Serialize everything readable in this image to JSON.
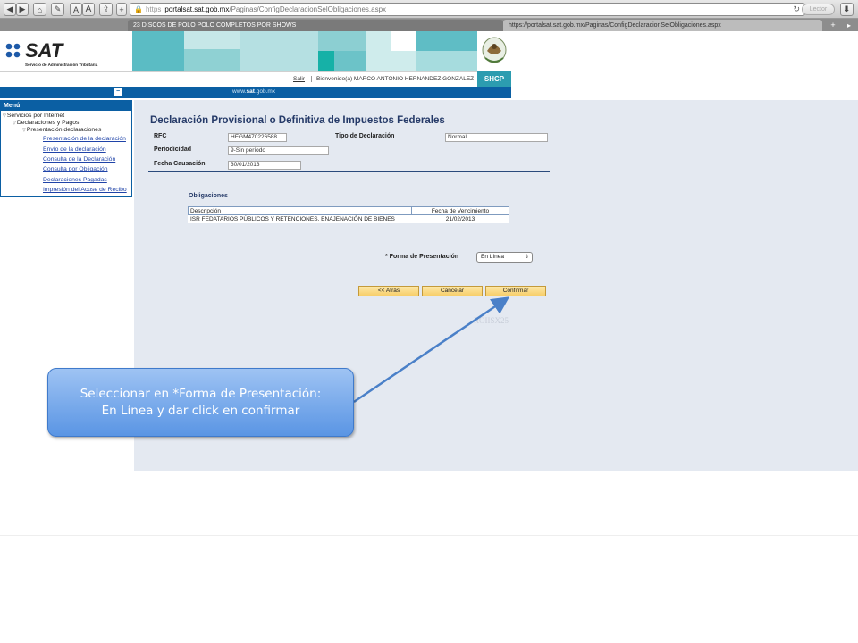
{
  "browser": {
    "address_https": "https",
    "address_domain": "portalsat.sat.gob.mx",
    "address_path": "/Paginas/ConfigDeclaracionSelObligaciones.aspx",
    "reader_label": "Lector",
    "tab1_title": "23 DISCOS DE POLO POLO COMPLETOS POR SHOWS",
    "tab2_title": "https://portalsat.sat.gob.mx/Paginas/ConfigDeclaracionSelObligaciones.aspx",
    "btn_a_small": "A",
    "btn_a_large": "A"
  },
  "header": {
    "logo_word": "SAT",
    "logo_subtitle": "Servicio de Administración Tributaria",
    "salir": "Salir",
    "welcome": "Bienvenido(a) MARCO ANTONIO HERNANDEZ GONZALEZ",
    "shcp": "SHCP",
    "site_url_pre": "www.",
    "site_url_bold": "sat",
    "site_url_post": ".gob.mx",
    "collapse": "−"
  },
  "menu": {
    "title": "Menú",
    "items": [
      {
        "label": "Servicios por Internet"
      },
      {
        "label": "Declaraciones y Pagos"
      },
      {
        "label": "Presentación declaraciones"
      }
    ],
    "links": [
      {
        "label": "Presentación de la declaración"
      },
      {
        "label": "Envío de la declaración"
      },
      {
        "label": "Consulta de la Declaración"
      },
      {
        "label": "Consulta por Obligación"
      },
      {
        "label": "Declaraciones Pagadas"
      },
      {
        "label": "Impresión del Acuse de Recibo"
      }
    ]
  },
  "form": {
    "title": "Declaración Provisional o Definitiva de Impuestos Federales",
    "rfc_label": "RFC",
    "rfc_value": "HEGM470226588",
    "tipo_label": "Tipo de Declaración",
    "tipo_value": "Normal",
    "periodicidad_label": "Periodicidad",
    "periodicidad_value": "9-Sin período",
    "fecha_label": "Fecha Causación",
    "fecha_value": "30/01/2013"
  },
  "obligaciones": {
    "title": "Obligaciones",
    "columns": [
      "Descripción",
      "Fecha de Vencimiento"
    ],
    "rows": [
      [
        "ISR FEDATARIOS PÚBLICOS Y RETENCIONES. ENAJENACIÓN DE BIENES",
        "21/02/2013"
      ]
    ]
  },
  "presentacion": {
    "label": "* Forma de Presentación",
    "selected": "En Línea"
  },
  "buttons": {
    "atras": "<< Atrás",
    "cancelar": "Cancelar",
    "confirmar": "Confirmar"
  },
  "watermark": "ROIISX25",
  "annotation": {
    "text": "Seleccionar en *Forma de Presentación: En Línea y dar click en confirmar"
  },
  "colors": {
    "brand_blue": "#0b5fa3",
    "shcp_teal": "#2c9cb0",
    "content_bg": "#e4e9f1",
    "button_yellow": "#f7ce6a",
    "callout_blue": "#5a95e4"
  }
}
